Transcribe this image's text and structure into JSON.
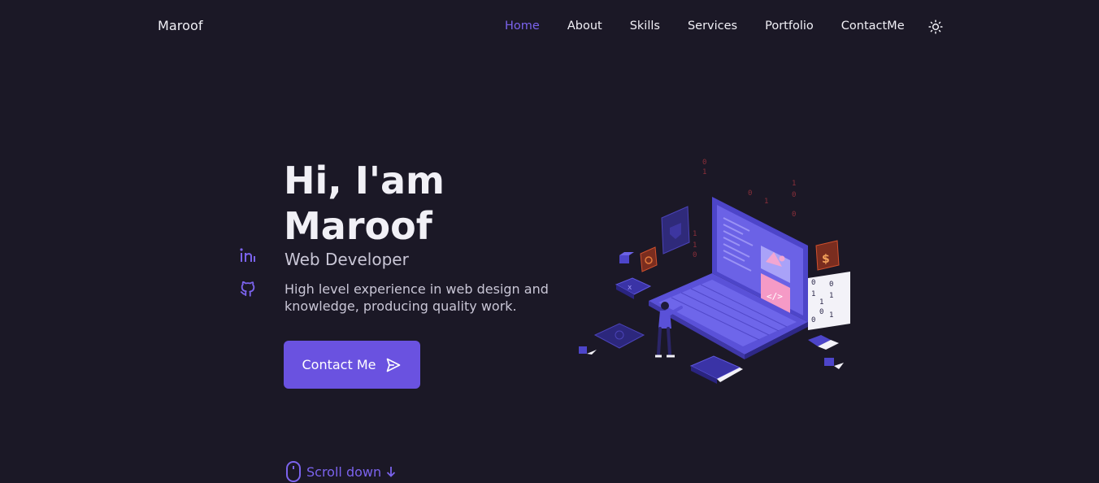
{
  "header": {
    "logo": "Maroof",
    "nav": [
      {
        "label": "Home",
        "active": true
      },
      {
        "label": "About",
        "active": false
      },
      {
        "label": "Skills",
        "active": false
      },
      {
        "label": "Services",
        "active": false
      },
      {
        "label": "Portfolio",
        "active": false
      },
      {
        "label": "ContactMe",
        "active": false
      }
    ],
    "theme_toggle_icon": "sun-icon"
  },
  "social": {
    "items": [
      {
        "icon": "linkedin-icon"
      },
      {
        "icon": "github-icon"
      }
    ]
  },
  "hero": {
    "title_line1": "Hi, I'am",
    "title_line2": "Maroof",
    "subtitle": "Web Developer",
    "description": "High level experience in web design and knowledge, producing quality work.",
    "cta_label": "Contact Me",
    "cta_icon": "send-icon",
    "scroll_label": "Scroll down",
    "scroll_icon": "mouse-icon",
    "scroll_arrow_icon": "arrow-down-icon"
  },
  "illustration": {
    "name": "developer-laptop-illustration",
    "binary_digits": [
      "0",
      "1",
      "0",
      "1",
      "1",
      "0",
      "0",
      "1",
      "1",
      "0"
    ]
  },
  "colors": {
    "background": "#1b1826",
    "accent": "#7b63ed",
    "button": "#6a52e0",
    "text": "#f1f0f6",
    "muted_text": "#c9c6d6"
  }
}
